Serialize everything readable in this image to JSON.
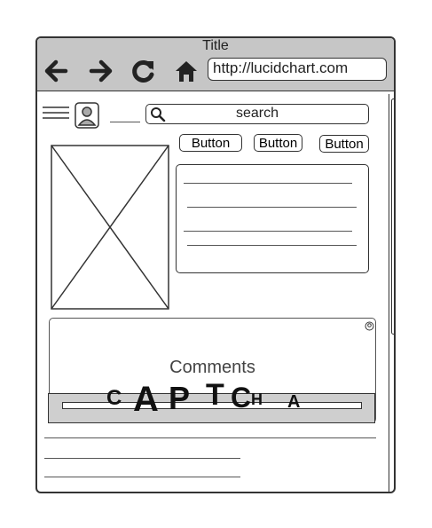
{
  "window": {
    "title": "Title",
    "url": "http://lucidchart.com"
  },
  "toolbar": {
    "icons": [
      "back-arrow-icon",
      "forward-arrow-icon",
      "refresh-icon",
      "home-icon"
    ]
  },
  "header": {
    "search_placeholder": "search",
    "buttons": [
      "Button",
      "Button",
      "Button"
    ]
  },
  "comments": {
    "label": "Comments",
    "captcha": [
      "C",
      "A",
      "P",
      "T",
      "C",
      "H",
      "A"
    ]
  }
}
